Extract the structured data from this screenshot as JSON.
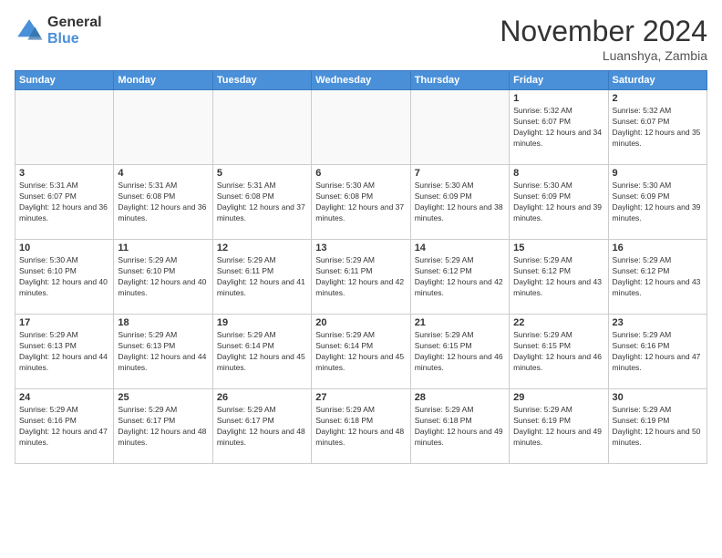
{
  "logo": {
    "general": "General",
    "blue": "Blue"
  },
  "title": "November 2024",
  "location": "Luanshya, Zambia",
  "days_header": [
    "Sunday",
    "Monday",
    "Tuesday",
    "Wednesday",
    "Thursday",
    "Friday",
    "Saturday"
  ],
  "weeks": [
    [
      {
        "day": "",
        "info": ""
      },
      {
        "day": "",
        "info": ""
      },
      {
        "day": "",
        "info": ""
      },
      {
        "day": "",
        "info": ""
      },
      {
        "day": "",
        "info": ""
      },
      {
        "day": "1",
        "info": "Sunrise: 5:32 AM\nSunset: 6:07 PM\nDaylight: 12 hours and 34 minutes."
      },
      {
        "day": "2",
        "info": "Sunrise: 5:32 AM\nSunset: 6:07 PM\nDaylight: 12 hours and 35 minutes."
      }
    ],
    [
      {
        "day": "3",
        "info": "Sunrise: 5:31 AM\nSunset: 6:07 PM\nDaylight: 12 hours and 36 minutes."
      },
      {
        "day": "4",
        "info": "Sunrise: 5:31 AM\nSunset: 6:08 PM\nDaylight: 12 hours and 36 minutes."
      },
      {
        "day": "5",
        "info": "Sunrise: 5:31 AM\nSunset: 6:08 PM\nDaylight: 12 hours and 37 minutes."
      },
      {
        "day": "6",
        "info": "Sunrise: 5:30 AM\nSunset: 6:08 PM\nDaylight: 12 hours and 37 minutes."
      },
      {
        "day": "7",
        "info": "Sunrise: 5:30 AM\nSunset: 6:09 PM\nDaylight: 12 hours and 38 minutes."
      },
      {
        "day": "8",
        "info": "Sunrise: 5:30 AM\nSunset: 6:09 PM\nDaylight: 12 hours and 39 minutes."
      },
      {
        "day": "9",
        "info": "Sunrise: 5:30 AM\nSunset: 6:09 PM\nDaylight: 12 hours and 39 minutes."
      }
    ],
    [
      {
        "day": "10",
        "info": "Sunrise: 5:30 AM\nSunset: 6:10 PM\nDaylight: 12 hours and 40 minutes."
      },
      {
        "day": "11",
        "info": "Sunrise: 5:29 AM\nSunset: 6:10 PM\nDaylight: 12 hours and 40 minutes."
      },
      {
        "day": "12",
        "info": "Sunrise: 5:29 AM\nSunset: 6:11 PM\nDaylight: 12 hours and 41 minutes."
      },
      {
        "day": "13",
        "info": "Sunrise: 5:29 AM\nSunset: 6:11 PM\nDaylight: 12 hours and 42 minutes."
      },
      {
        "day": "14",
        "info": "Sunrise: 5:29 AM\nSunset: 6:12 PM\nDaylight: 12 hours and 42 minutes."
      },
      {
        "day": "15",
        "info": "Sunrise: 5:29 AM\nSunset: 6:12 PM\nDaylight: 12 hours and 43 minutes."
      },
      {
        "day": "16",
        "info": "Sunrise: 5:29 AM\nSunset: 6:12 PM\nDaylight: 12 hours and 43 minutes."
      }
    ],
    [
      {
        "day": "17",
        "info": "Sunrise: 5:29 AM\nSunset: 6:13 PM\nDaylight: 12 hours and 44 minutes."
      },
      {
        "day": "18",
        "info": "Sunrise: 5:29 AM\nSunset: 6:13 PM\nDaylight: 12 hours and 44 minutes."
      },
      {
        "day": "19",
        "info": "Sunrise: 5:29 AM\nSunset: 6:14 PM\nDaylight: 12 hours and 45 minutes."
      },
      {
        "day": "20",
        "info": "Sunrise: 5:29 AM\nSunset: 6:14 PM\nDaylight: 12 hours and 45 minutes."
      },
      {
        "day": "21",
        "info": "Sunrise: 5:29 AM\nSunset: 6:15 PM\nDaylight: 12 hours and 46 minutes."
      },
      {
        "day": "22",
        "info": "Sunrise: 5:29 AM\nSunset: 6:15 PM\nDaylight: 12 hours and 46 minutes."
      },
      {
        "day": "23",
        "info": "Sunrise: 5:29 AM\nSunset: 6:16 PM\nDaylight: 12 hours and 47 minutes."
      }
    ],
    [
      {
        "day": "24",
        "info": "Sunrise: 5:29 AM\nSunset: 6:16 PM\nDaylight: 12 hours and 47 minutes."
      },
      {
        "day": "25",
        "info": "Sunrise: 5:29 AM\nSunset: 6:17 PM\nDaylight: 12 hours and 48 minutes."
      },
      {
        "day": "26",
        "info": "Sunrise: 5:29 AM\nSunset: 6:17 PM\nDaylight: 12 hours and 48 minutes."
      },
      {
        "day": "27",
        "info": "Sunrise: 5:29 AM\nSunset: 6:18 PM\nDaylight: 12 hours and 48 minutes."
      },
      {
        "day": "28",
        "info": "Sunrise: 5:29 AM\nSunset: 6:18 PM\nDaylight: 12 hours and 49 minutes."
      },
      {
        "day": "29",
        "info": "Sunrise: 5:29 AM\nSunset: 6:19 PM\nDaylight: 12 hours and 49 minutes."
      },
      {
        "day": "30",
        "info": "Sunrise: 5:29 AM\nSunset: 6:19 PM\nDaylight: 12 hours and 50 minutes."
      }
    ]
  ]
}
